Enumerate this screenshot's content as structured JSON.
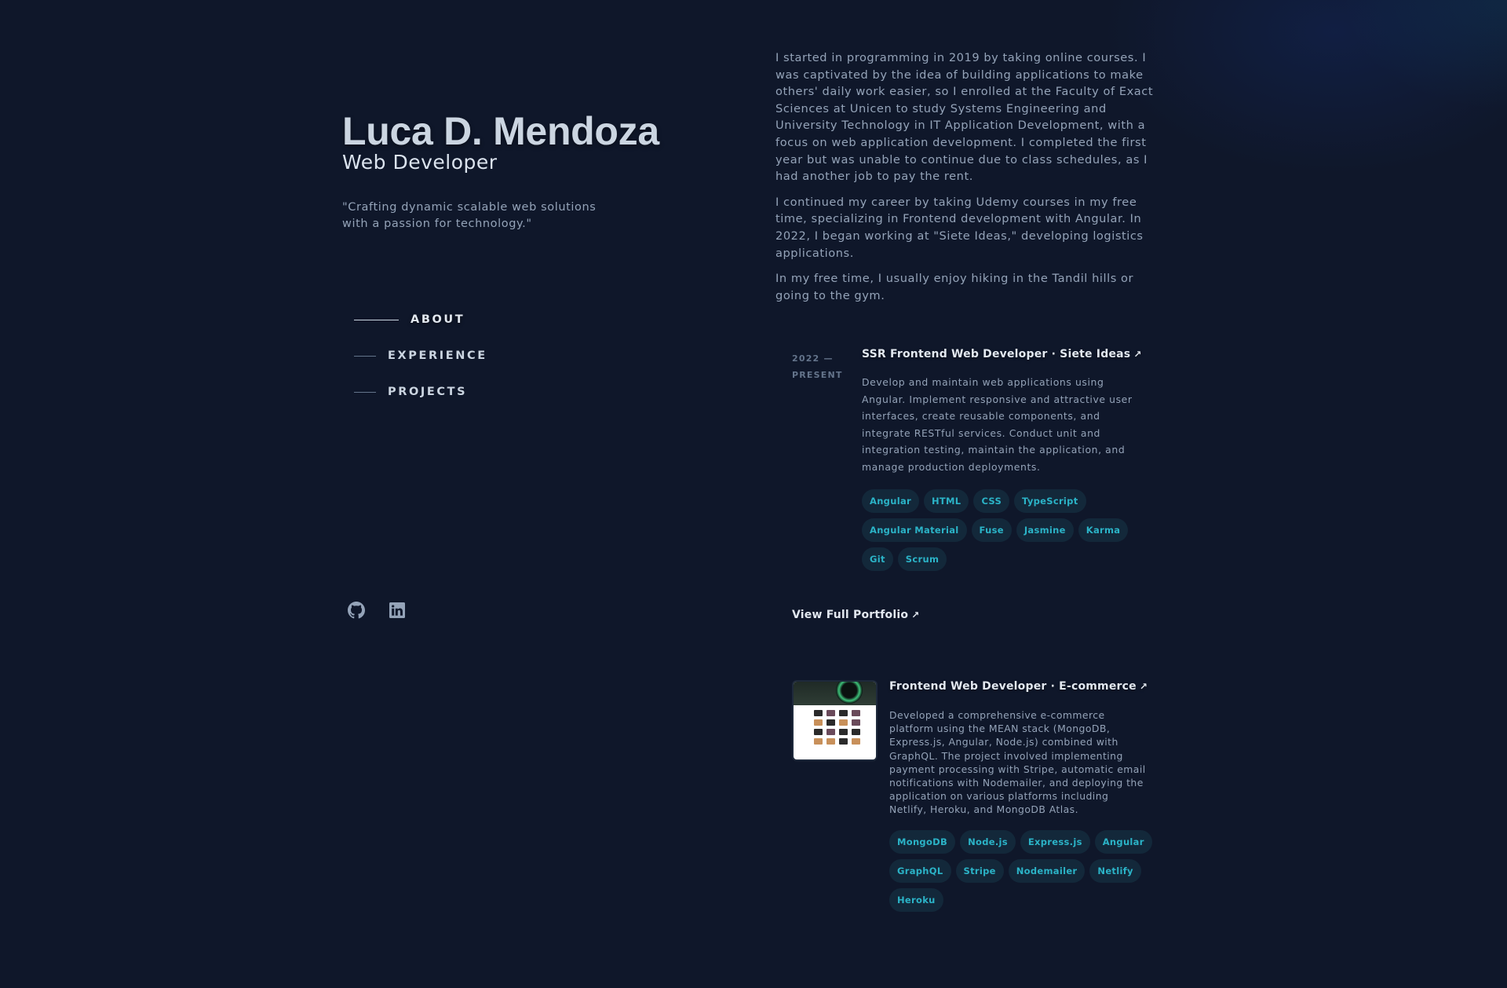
{
  "header": {
    "name": "Luca D. Mendoza",
    "role": "Web Developer",
    "tagline": "\"Crafting dynamic scalable web solutions with a passion for technology.\""
  },
  "nav": {
    "items": [
      {
        "label": "ABOUT",
        "active": true
      },
      {
        "label": "EXPERIENCE",
        "active": false
      },
      {
        "label": "PROJECTS",
        "active": false
      }
    ]
  },
  "socials": [
    {
      "icon": "github-icon"
    },
    {
      "icon": "linkedin-icon"
    }
  ],
  "about": {
    "paragraphs": [
      "I started in programming in 2019 by taking online courses. I was captivated by the idea of building applications to make others' daily work easier, so I enrolled at the Faculty of Exact Sciences at Unicen to study Systems Engineering and University Technology in IT Application Development, with a focus on web application development. I completed the first year but was unable to continue due to class schedules, as I had another job to pay the rent.",
      "I continued my career by taking Udemy courses in my free time, specializing in Frontend development with Angular. In 2022, I began working at \"Siete Ideas,\" developing logistics applications.",
      "In my free time, I usually enjoy hiking in the Tandil hills or going to the gym."
    ]
  },
  "experience": {
    "date": "2022 — PRESENT",
    "title": "SSR Frontend Web Developer · Siete Ideas",
    "arrow": "↗",
    "description": "Develop and maintain web applications using Angular. Implement responsive and attractive user interfaces, create reusable components, and integrate RESTful services. Conduct unit and integration testing, maintain the application, and manage production deployments.",
    "tags": [
      "Angular",
      "HTML",
      "CSS",
      "TypeScript",
      "Angular Material",
      "Fuse",
      "Jasmine",
      "Karma",
      "Git",
      "Scrum"
    ]
  },
  "portfolio_link": {
    "label": "View Full Portfolio",
    "arrow": "↗"
  },
  "project": {
    "title": "Frontend Web Developer · E-commerce",
    "arrow": "↗",
    "description": "Developed a comprehensive e-commerce platform using the MEAN stack (MongoDB, Express.js, Angular, Node.js) combined with GraphQL. The project involved implementing payment processing with Stripe, automatic email notifications with Nodemailer, and deploying the application on various platforms including Netlify, Heroku, and MongoDB Atlas.",
    "tags": [
      "MongoDB",
      "Node.js",
      "Express.js",
      "Angular",
      "GraphQL",
      "Stripe",
      "Nodemailer",
      "Netlify",
      "Heroku"
    ]
  },
  "colors": {
    "background": "#0f172a",
    "accent": "#2bb3c7",
    "heading": "#e2e8f0",
    "body_text": "#94a3b8"
  }
}
